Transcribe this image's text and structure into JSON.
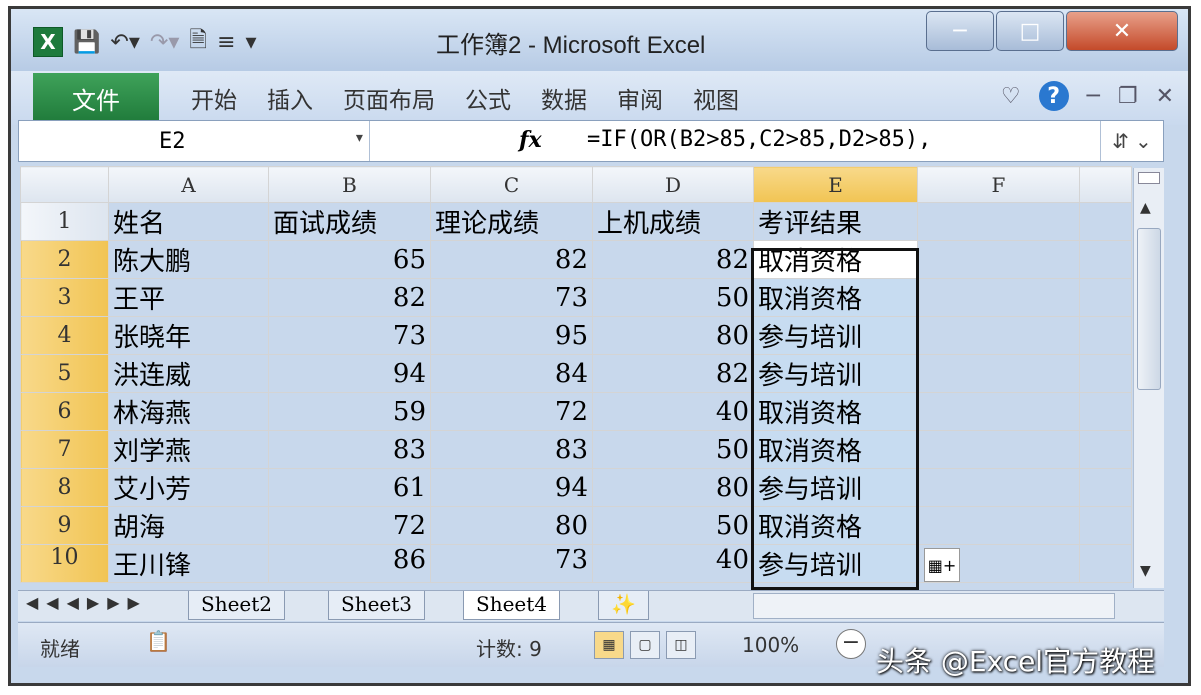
{
  "window": {
    "title": "工作簿2 - Microsoft Excel",
    "app_icon": "X"
  },
  "ribbon": {
    "file_tab": "文件",
    "tabs": [
      "开始",
      "插入",
      "页面布局",
      "公式",
      "数据",
      "审阅",
      "视图"
    ]
  },
  "formula_bar": {
    "name_box": "E2",
    "fx_label": "fx",
    "formula": "=IF(OR(B2>85,C2>85,D2>85),"
  },
  "grid": {
    "columns": [
      "A",
      "B",
      "C",
      "D",
      "E",
      "F"
    ],
    "row_numbers": [
      "1",
      "2",
      "3",
      "4",
      "5",
      "6",
      "7",
      "8",
      "9",
      "10"
    ],
    "header_row": [
      "姓名",
      "面试成绩",
      "理论成绩",
      "上机成绩",
      "考评结果"
    ],
    "rows": [
      {
        "name": "陈大鹏",
        "b": "65",
        "c": "82",
        "d": "82",
        "e": "取消资格"
      },
      {
        "name": "王平",
        "b": "82",
        "c": "73",
        "d": "50",
        "e": "取消资格"
      },
      {
        "name": "张晓年",
        "b": "73",
        "c": "95",
        "d": "80",
        "e": "参与培训"
      },
      {
        "name": "洪连威",
        "b": "94",
        "c": "84",
        "d": "82",
        "e": "参与培训"
      },
      {
        "name": "林海燕",
        "b": "59",
        "c": "72",
        "d": "40",
        "e": "取消资格"
      },
      {
        "name": "刘学燕",
        "b": "83",
        "c": "83",
        "d": "50",
        "e": "取消资格"
      },
      {
        "name": "艾小芳",
        "b": "61",
        "c": "94",
        "d": "80",
        "e": "参与培训"
      },
      {
        "name": "胡海",
        "b": "72",
        "c": "80",
        "d": "50",
        "e": "取消资格"
      },
      {
        "name": "王川锋",
        "b": "86",
        "c": "73",
        "d": "40",
        "e": "参与培训"
      }
    ]
  },
  "sheets": {
    "tabs": [
      "Sheet2",
      "Sheet3",
      "Sheet4"
    ],
    "active": "Sheet4"
  },
  "status": {
    "ready": "就绪",
    "count": "计数: 9",
    "zoom": "100%"
  },
  "watermark": "头条 @Excel官方教程"
}
